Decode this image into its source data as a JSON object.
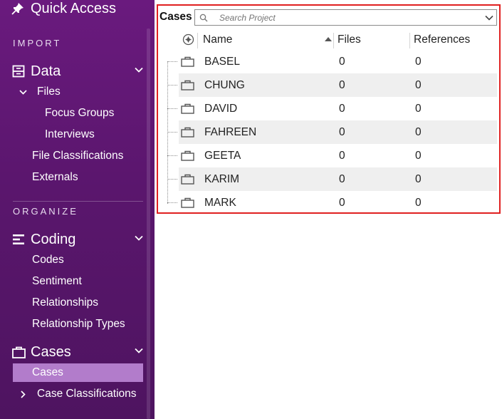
{
  "sidebar": {
    "quick_access": "Quick Access",
    "sections": {
      "import": "IMPORT",
      "organize": "ORGANIZE"
    },
    "data_group": {
      "label": "Data",
      "items": {
        "files": "Files",
        "focus_groups": "Focus Groups",
        "interviews": "Interviews",
        "file_classifications": "File Classifications",
        "externals": "Externals"
      }
    },
    "coding_group": {
      "label": "Coding",
      "items": {
        "codes": "Codes",
        "sentiment": "Sentiment",
        "relationships": "Relationships",
        "relationship_types": "Relationship Types"
      }
    },
    "cases_group": {
      "label": "Cases",
      "items": {
        "cases": "Cases",
        "case_classifications": "Case Classifications"
      }
    },
    "colors": {
      "background": "#5e176f",
      "selected": "#b27ccb"
    }
  },
  "panel": {
    "title": "Cases",
    "search_placeholder": "Search Project",
    "columns": {
      "name": "Name",
      "files": "Files",
      "references": "References"
    },
    "sort_indicator": "ascending",
    "rows": [
      {
        "name": "BASEL",
        "files": "0",
        "references": "0"
      },
      {
        "name": "CHUNG",
        "files": "0",
        "references": "0"
      },
      {
        "name": "DAVID",
        "files": "0",
        "references": "0"
      },
      {
        "name": "FAHREEN",
        "files": "0",
        "references": "0"
      },
      {
        "name": "GEETA",
        "files": "0",
        "references": "0"
      },
      {
        "name": "KARIM",
        "files": "0",
        "references": "0"
      },
      {
        "name": "MARK",
        "files": "0",
        "references": "0"
      }
    ],
    "colors": {
      "highlight_border": "#e02020",
      "alt_row": "#efefef"
    }
  },
  "icons": {
    "quick_access": "pin-icon",
    "data": "data-icon",
    "coding": "coding-icon",
    "cases": "briefcase-icon",
    "case_row": "briefcase-icon",
    "search": "search-icon",
    "add_column": "add-column-icon"
  }
}
